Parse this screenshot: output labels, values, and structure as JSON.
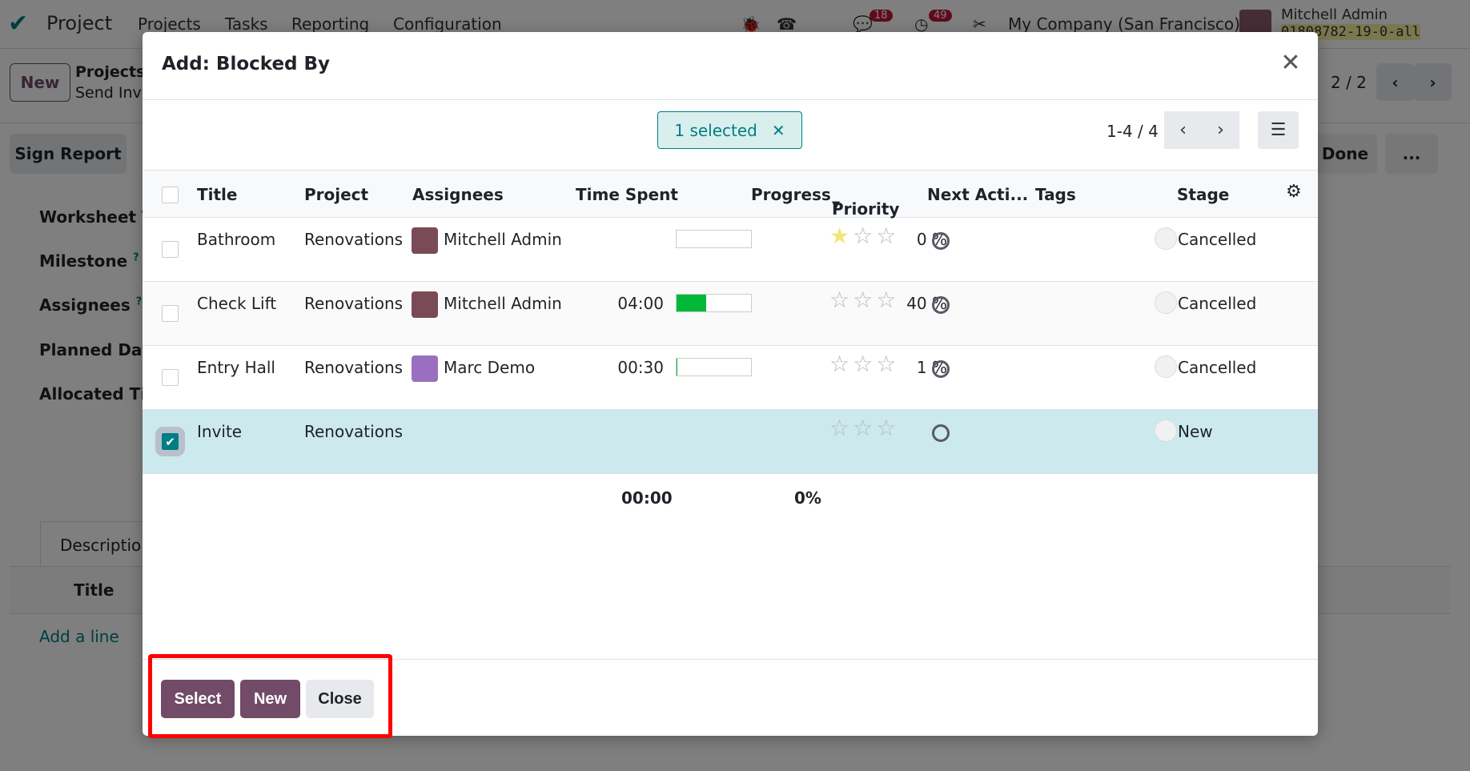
{
  "navbar": {
    "app": "Project",
    "menu": [
      "Projects",
      "Tasks",
      "Reporting",
      "Configuration"
    ],
    "badges": {
      "messages": "18",
      "activities": "49"
    },
    "company": "My Company (San Francisco)",
    "user": "Mitchell Admin",
    "db": "01808782-19-0-all"
  },
  "background": {
    "new_button": "New",
    "breadcrumb": [
      "Projects",
      "Send Invi"
    ],
    "pager": "2 / 2",
    "sign_report": "Sign Report",
    "done": "Done",
    "more": "...",
    "fields": [
      "Worksheet Te",
      "Milestone",
      "Assignees",
      "Planned Date",
      "Allocated Tim"
    ],
    "tab": "Description",
    "table_title": "Title",
    "add_line": "Add a line"
  },
  "dialog": {
    "title": "Add: Blocked By",
    "selected_label": "1 selected",
    "pager": "1-4 / 4",
    "columns": [
      "Title",
      "Project",
      "Assignees",
      "Time Spent",
      "Progress",
      "Priority",
      "Next Acti...",
      "Tags",
      "Stage"
    ],
    "rows": [
      {
        "title": "Bathroom",
        "project": "Renovations",
        "assignee": "Mitchell Admin",
        "avatar": "mitchell",
        "time": "",
        "progress": 0,
        "progress_label": "0 %",
        "priority": 1,
        "stage": "Cancelled",
        "selected": false
      },
      {
        "title": "Check Lift",
        "project": "Renovations",
        "assignee": "Mitchell Admin",
        "avatar": "mitchell",
        "time": "04:00",
        "progress": 40,
        "progress_label": "40 %",
        "priority": 0,
        "stage": "Cancelled",
        "selected": false
      },
      {
        "title": "Entry Hall",
        "project": "Renovations",
        "assignee": "Marc Demo",
        "avatar": "marc",
        "time": "00:30",
        "progress": 1,
        "progress_label": "1 %",
        "priority": 0,
        "stage": "Cancelled",
        "selected": false
      },
      {
        "title": "Invite",
        "project": "Renovations",
        "assignee": "",
        "avatar": "",
        "time": "",
        "progress": null,
        "progress_label": "",
        "priority": 0,
        "stage": "New",
        "selected": true
      }
    ],
    "totals": {
      "time": "00:00",
      "progress": "0%"
    },
    "buttons": {
      "select": "Select",
      "new": "New",
      "close": "Close"
    }
  }
}
